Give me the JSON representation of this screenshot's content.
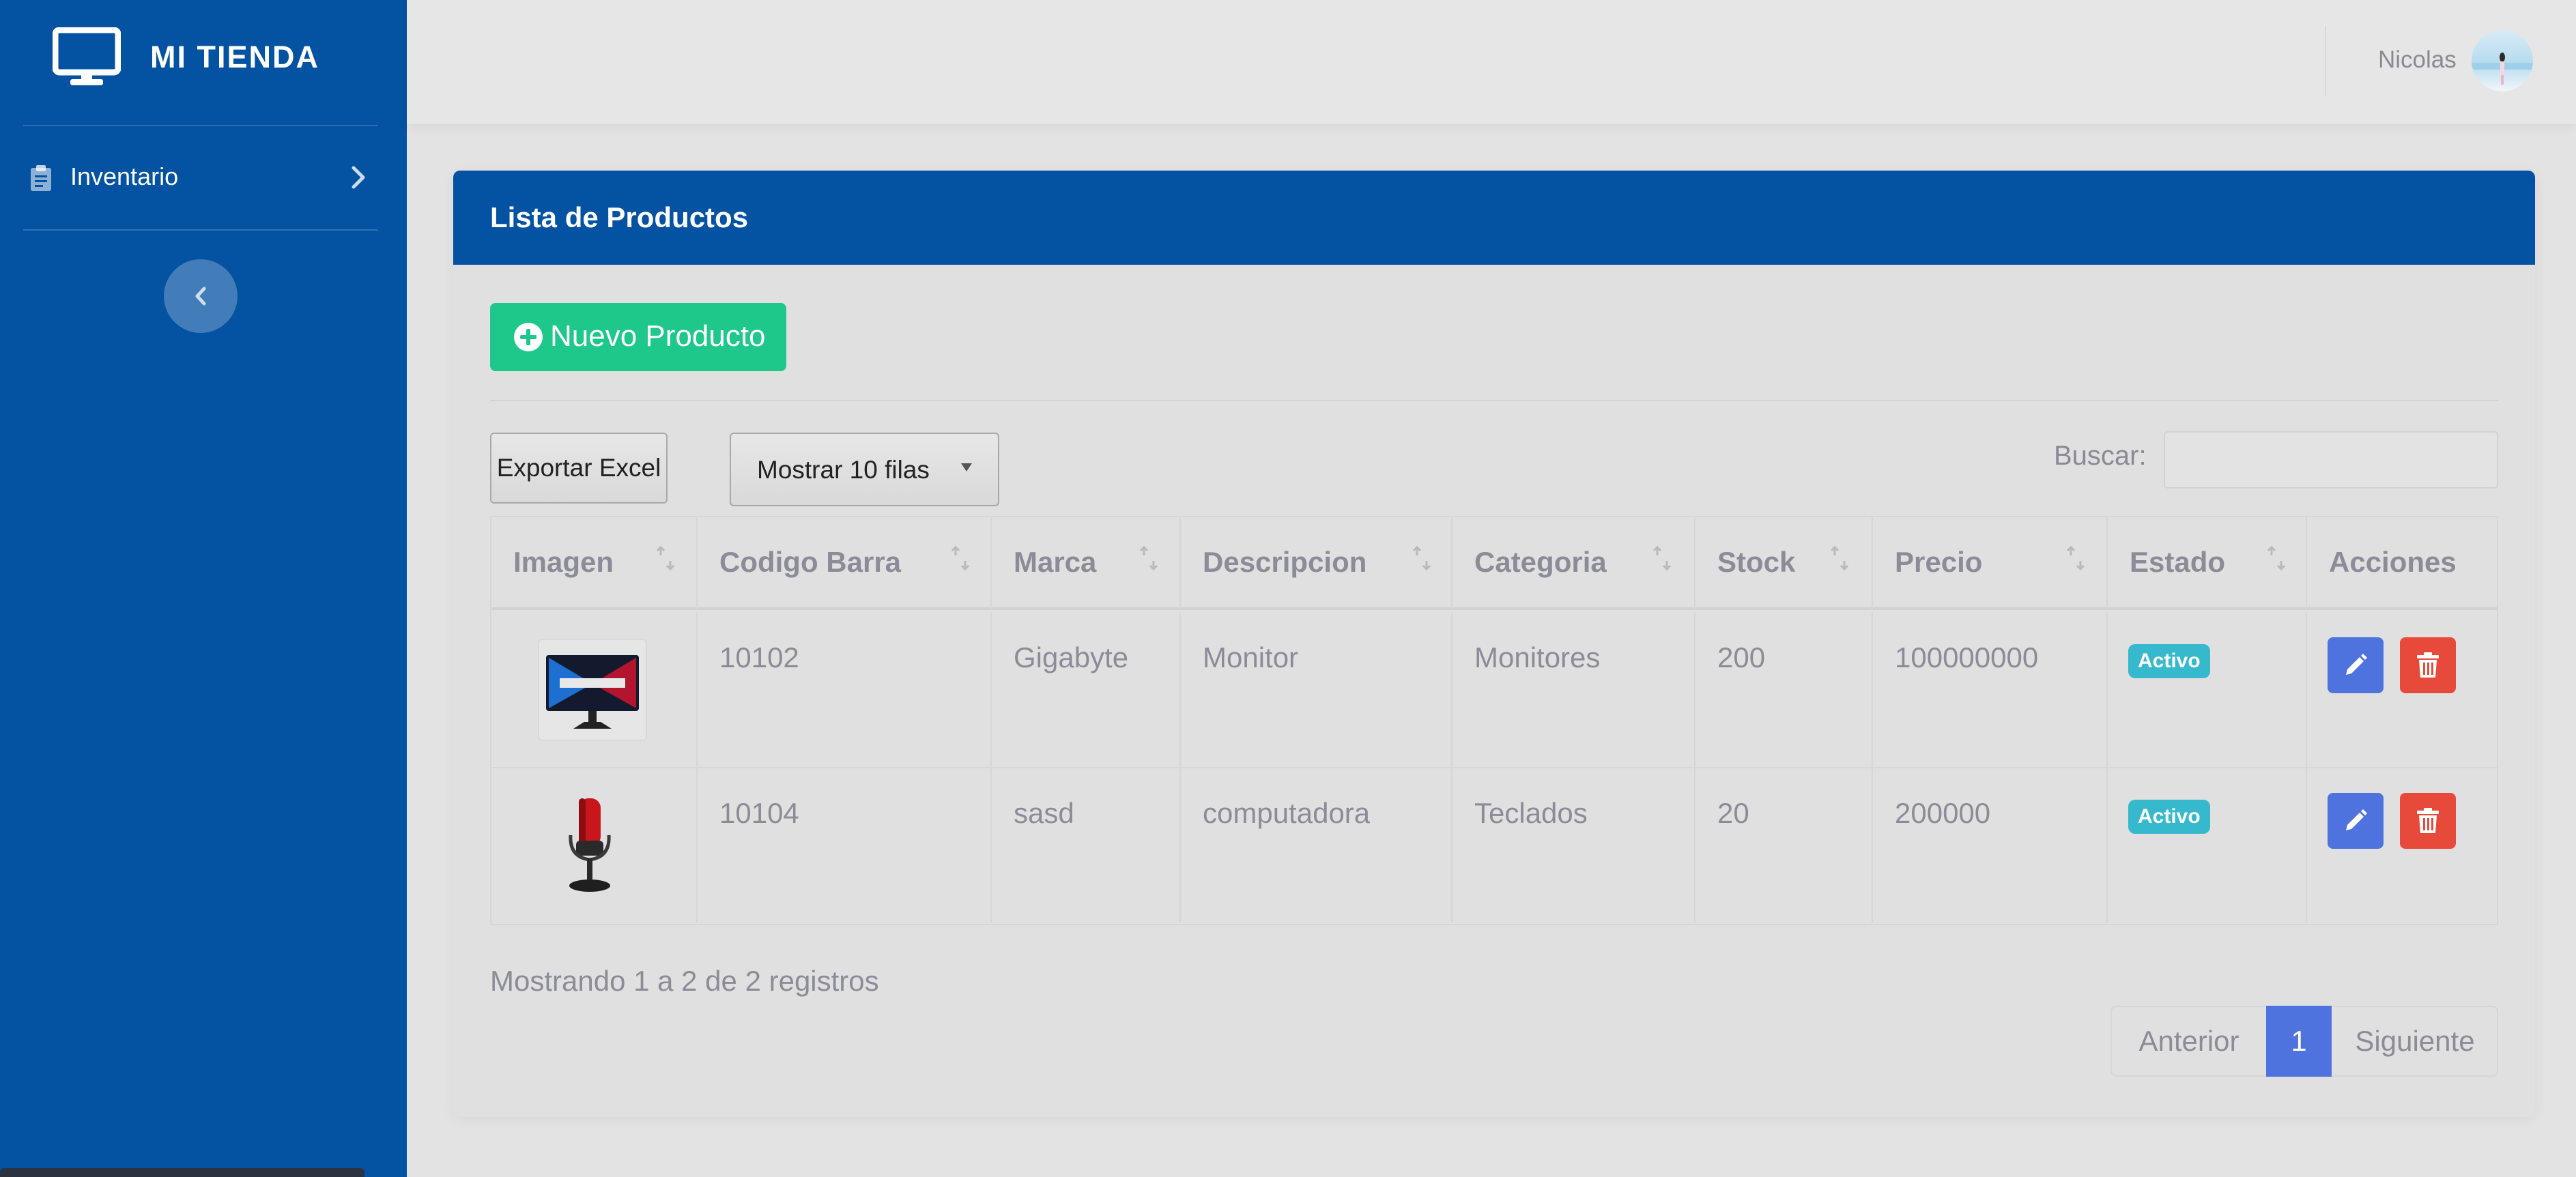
{
  "brand": {
    "name": "MI TIENDA",
    "icon": "monitor-icon"
  },
  "sidebar": {
    "items": [
      {
        "label": "Inventario",
        "icon": "clipboard-icon"
      }
    ],
    "toggle_icon": "chevron-left-icon"
  },
  "topbar": {
    "user_name": "Nicolas"
  },
  "card": {
    "title": "Lista de Productos",
    "new_button": "Nuevo Producto",
    "export_button": "Exportar Excel",
    "page_length_button": "Mostrar 10 filas",
    "search_label": "Buscar:",
    "search_value": ""
  },
  "table": {
    "columns": [
      "Imagen",
      "Codigo Barra",
      "Marca",
      "Descripcion",
      "Categoria",
      "Stock",
      "Precio",
      "Estado",
      "Acciones"
    ],
    "rows": [
      {
        "image": "monitor-product-image",
        "barcode": "10102",
        "brand": "Gigabyte",
        "description": "Monitor",
        "category": "Monitores",
        "stock": "200",
        "price": "100000000",
        "status": "Activo"
      },
      {
        "image": "microphone-product-image",
        "barcode": "10104",
        "brand": "sasd",
        "description": "computadora",
        "category": "Teclados",
        "stock": "20",
        "price": "200000",
        "status": "Activo"
      }
    ]
  },
  "footer": {
    "info": "Mostrando 1 a 2 de 2 registros",
    "prev": "Anterior",
    "page": "1",
    "next": "Siguiente"
  },
  "colors": {
    "primary": "#0452a2",
    "success": "#1dc88a",
    "info": "#36b9cc",
    "edit": "#4e73df",
    "danger": "#e74a3b",
    "background": "#e3e3e3"
  }
}
